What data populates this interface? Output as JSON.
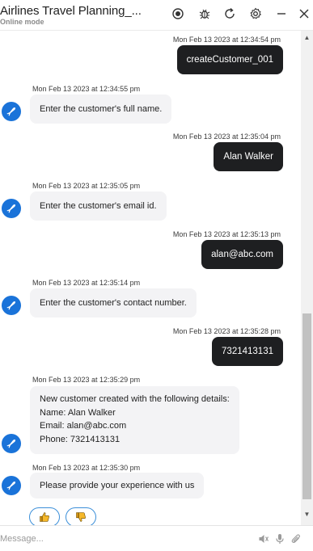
{
  "header": {
    "title": "Airlines Travel Planning_...",
    "subtitle": "Online mode"
  },
  "messages": [
    {
      "timestamp": "Mon Feb 13 2023 at 12:34:54 pm",
      "text": "createCustomer_001"
    },
    {
      "timestamp": "Mon Feb 13 2023 at 12:34:55 pm",
      "text": "Enter the customer's full name."
    },
    {
      "timestamp": "Mon Feb 13 2023 at 12:35:04 pm",
      "text": "Alan Walker"
    },
    {
      "timestamp": "Mon Feb 13 2023 at 12:35:05 pm",
      "text": "Enter the customer's email id."
    },
    {
      "timestamp": "Mon Feb 13 2023 at 12:35:13 pm",
      "text": "alan@abc.com"
    },
    {
      "timestamp": "Mon Feb 13 2023 at 12:35:14 pm",
      "text": "Enter the customer's contact number."
    },
    {
      "timestamp": "Mon Feb 13 2023 at 12:35:28 pm",
      "text": "7321413131"
    },
    {
      "timestamp": "Mon Feb 13 2023 at 12:35:29 pm",
      "lines": [
        "New customer created with the following details:",
        "Name: Alan Walker",
        "Email: alan@abc.com",
        "Phone: 7321413131"
      ]
    },
    {
      "timestamp": "Mon Feb 13 2023 at 12:35:30 pm",
      "text": "Please provide your experience with us"
    }
  ],
  "composer": {
    "placeholder": "Message..."
  },
  "colors": {
    "user_bubble": "#1e1f21",
    "bot_bubble": "#f3f3f5",
    "bot_avatar": "#1a73d9",
    "feedback_border": "#3b8fd9",
    "thumbs_up": "#e8a317",
    "thumbs_down": "#e8a317"
  },
  "icons": {
    "header": [
      "record-icon",
      "bug-icon",
      "refresh-icon",
      "settings-icon",
      "minimize-icon",
      "close-icon"
    ],
    "bot_avatar": "airplane-icon",
    "feedback": [
      "thumbs-up-icon",
      "thumbs-down-icon"
    ],
    "composer": [
      "speaker-icon",
      "microphone-icon",
      "attachment-icon"
    ]
  }
}
